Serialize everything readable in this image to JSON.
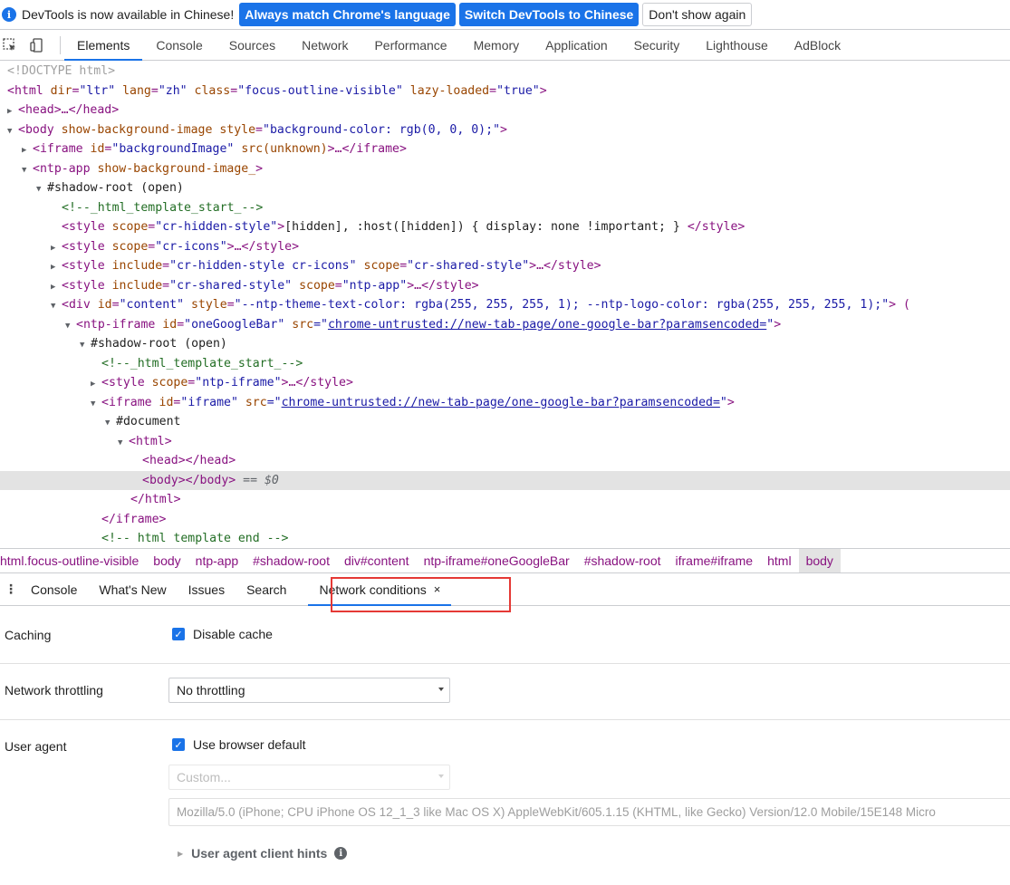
{
  "infobar": {
    "message": "DevTools is now available in Chinese!",
    "btn_match": "Always match Chrome's language",
    "btn_switch": "Switch DevTools to Chinese",
    "btn_dismiss": "Don't show again"
  },
  "main_tabs": [
    "Elements",
    "Console",
    "Sources",
    "Network",
    "Performance",
    "Memory",
    "Application",
    "Security",
    "Lighthouse",
    "AdBlock"
  ],
  "tree": {
    "doctype": "<!DOCTYPE html>",
    "html_open": {
      "tag": "<html",
      "a1": "dir",
      "v1": "\"ltr\"",
      "a2": "lang",
      "v2": "\"zh\"",
      "a3": "class",
      "v3": "\"focus-outline-visible\"",
      "a4": "lazy-loaded",
      "v4": "\"true\"",
      "close": ">"
    },
    "head": "<head>…</head>",
    "body_open": {
      "tag": "<body",
      "a1": "show-background-image",
      "a2": "style",
      "v2": "\"background-color: rgb(0, 0, 0);\"",
      "close": ">"
    },
    "iframe_bg": {
      "tag": "<iframe",
      "a1": "id",
      "v1": "\"backgroundImage\"",
      "a2": "src(unknown)",
      "rest": ">…</iframe>"
    },
    "ntp_app": {
      "tag": "<ntp-app",
      "a1": "show-background-image_",
      "close": ">"
    },
    "shadow1": "#shadow-root (open)",
    "comment1": "<!--_html_template_start_-->",
    "style1": {
      "tag": "<style",
      "a1": "scope",
      "v1": "\"cr-hidden-style\"",
      "mid": ">",
      "text": "[hidden], :host([hidden]) { display: none !important; } ",
      "end": "</style>"
    },
    "style2": {
      "tag": "<style",
      "a1": "scope",
      "v1": "\"cr-icons\"",
      "rest": ">…</style>"
    },
    "style3": {
      "tag": "<style",
      "a1": "include",
      "v1": "\"cr-hidden-style cr-icons\"",
      "a2": "scope",
      "v2": "\"cr-shared-style\"",
      "rest": ">…</style>"
    },
    "style4": {
      "tag": "<style",
      "a1": "include",
      "v1": "\"cr-shared-style\"",
      "a2": "scope",
      "v2": "\"ntp-app\"",
      "rest": ">…</style>"
    },
    "div_content": {
      "tag": "<div",
      "a1": "id",
      "v1": "\"content\"",
      "a2": "style",
      "v2": "\"--ntp-theme-text-color: rgba(255, 255, 255, 1); --ntp-logo-color: rgba(255, 255, 255, 1);\"",
      "close": "> ("
    },
    "ntp_iframe": {
      "tag": "<ntp-iframe",
      "a1": "id",
      "v1": "\"oneGoogleBar\"",
      "a2": "src",
      "q1": "=\"",
      "link": "chrome-untrusted://new-tab-page/one-google-bar?paramsencoded=",
      "q2": "\"",
      "close": ">"
    },
    "shadow2": "#shadow-root (open)",
    "comment2": "<!--_html_template_start_-->",
    "style5": {
      "tag": "<style",
      "a1": "scope",
      "v1": "\"ntp-iframe\"",
      "rest": ">…</style>"
    },
    "iframe2": {
      "tag": "<iframe",
      "a1": "id",
      "v1": "\"iframe\"",
      "a2": "src",
      "q1": "=\"",
      "link": "chrome-untrusted://new-tab-page/one-google-bar?paramsencoded=",
      "q2": "\"",
      "close": ">"
    },
    "document": "#document",
    "html2": "<html>",
    "head2": "<head></head>",
    "body2": "<body></body>",
    "body2_marker": " == $0",
    "html2_close": "</html>",
    "iframe_close": "</iframe>",
    "comment3": "<!-- html template end -->"
  },
  "breadcrumbs": [
    "html.focus-outline-visible",
    "body",
    "ntp-app",
    "#shadow-root",
    "div#content",
    "ntp-iframe#oneGoogleBar",
    "#shadow-root",
    "iframe#iframe",
    "html",
    "body"
  ],
  "drawer": {
    "kebab": "⋮",
    "tabs": [
      "Console",
      "What's New",
      "Issues",
      "Search"
    ],
    "active_tab": "Network conditions",
    "close": "×"
  },
  "network_conditions": {
    "caching_label": "Caching",
    "disable_cache_label": "Disable cache",
    "disable_cache_checked": true,
    "throttling_label": "Network throttling",
    "throttling_value": "No throttling",
    "user_agent_label": "User agent",
    "use_default_label": "Use browser default",
    "use_default_checked": true,
    "custom_placeholder": "Custom...",
    "ua_string": "Mozilla/5.0 (iPhone; CPU iPhone OS 12_1_3 like Mac OS X) AppleWebKit/605.1.15 (KHTML, like Gecko) Version/12.0 Mobile/15E148 Micro",
    "client_hints_label": "User agent client hints"
  },
  "colors": {
    "accent": "#1a73e8",
    "highlight_box": "#e53935",
    "tag": "#881280",
    "attr_name": "#994500",
    "attr_value": "#1a1aa6",
    "comment": "#236e25"
  }
}
